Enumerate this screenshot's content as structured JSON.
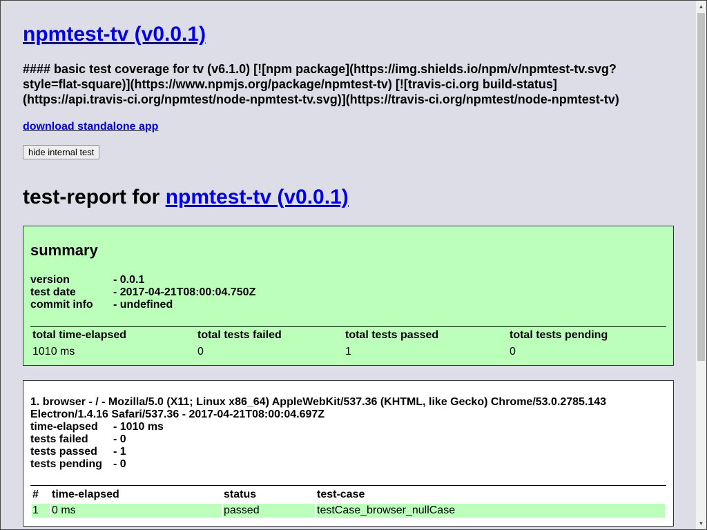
{
  "page": {
    "title_link": "npmtest-tv (v0.0.1)",
    "description": "#### basic test coverage for tv (v6.1.0) [![npm package](https://img.shields.io/npm/v/npmtest-tv.svg?style=flat-square)](https://www.npmjs.org/package/npmtest-tv) [![travis-ci.org build-status](https://api.travis-ci.org/npmtest/node-npmtest-tv.svg)](https://travis-ci.org/npmtest/node-npmtest-tv)",
    "download_link": "download standalone app",
    "hide_button": "hide internal test",
    "report_prefix": "test-report for ",
    "report_link": "npmtest-tv (v0.0.1)"
  },
  "summary": {
    "heading": "summary",
    "rows": [
      {
        "key": "version",
        "value": "- 0.0.1"
      },
      {
        "key": "test date",
        "value": "- 2017-04-21T08:00:04.750Z"
      },
      {
        "key": "commit info",
        "value": "- undefined"
      }
    ],
    "table_headers": [
      "total time-elapsed",
      "total tests failed",
      "total tests passed",
      "total tests pending"
    ],
    "table_values": [
      "1010 ms",
      "0",
      "1",
      "0"
    ]
  },
  "browser": {
    "heading": "1. browser - / - Mozilla/5.0 (X11; Linux x86_64) AppleWebKit/537.36 (KHTML, like Gecko) Chrome/53.0.2785.143 Electron/1.4.16 Safari/537.36 - 2017-04-21T08:00:04.697Z",
    "rows": [
      {
        "key": "time-elapsed",
        "value": "- 1010 ms"
      },
      {
        "key": "tests failed",
        "value": "- 0"
      },
      {
        "key": "tests passed",
        "value": "- 1"
      },
      {
        "key": "tests pending",
        "value": "- 0"
      }
    ],
    "table_headers": [
      "#",
      "time-elapsed",
      "status",
      "test-case"
    ],
    "table_rows": [
      [
        "1",
        "0 ms",
        "passed",
        "testCase_browser_nullCase"
      ]
    ]
  },
  "colors": {
    "background": "#dddde8",
    "pass_green": "#bbffbb",
    "link": "#0000ee"
  },
  "scrollbar": {
    "scroll_position": 0.0,
    "visible_fraction": 0.69
  }
}
